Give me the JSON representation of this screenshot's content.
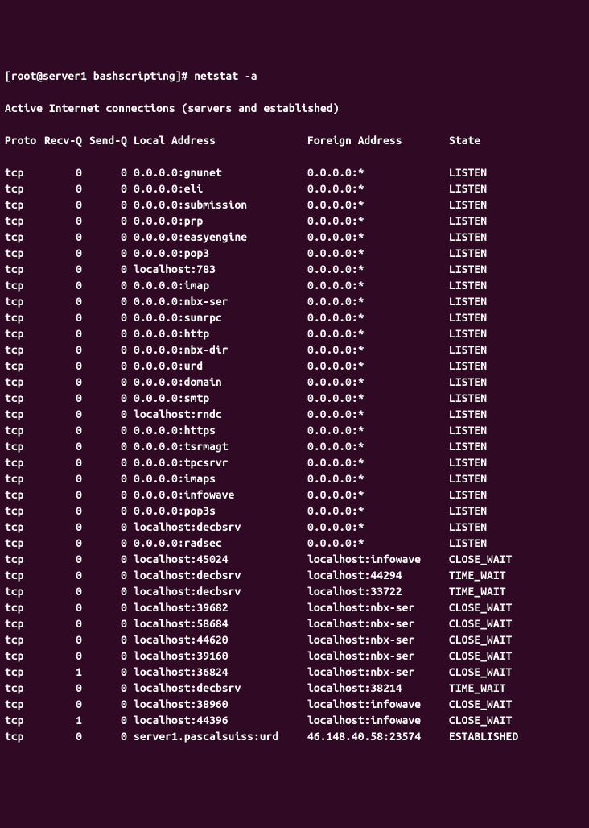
{
  "prompt": "[root@server1 bashscripting]# ",
  "command": "netstat -a",
  "header1": "Active Internet connections (servers and established)",
  "columns": {
    "proto": "Proto",
    "recvq": "Recv-Q",
    "sendq": "Send-Q",
    "local": "Local Address",
    "foreign": "Foreign Address",
    "state": "State"
  },
  "rows": [
    {
      "proto": "tcp",
      "recvq": "0",
      "sendq": "0",
      "local": "0.0.0.0:gnunet",
      "foreign": "0.0.0.0:*",
      "state": "LISTEN"
    },
    {
      "proto": "tcp",
      "recvq": "0",
      "sendq": "0",
      "local": "0.0.0.0:eli",
      "foreign": "0.0.0.0:*",
      "state": "LISTEN"
    },
    {
      "proto": "tcp",
      "recvq": "0",
      "sendq": "0",
      "local": "0.0.0.0:submission",
      "foreign": "0.0.0.0:*",
      "state": "LISTEN"
    },
    {
      "proto": "tcp",
      "recvq": "0",
      "sendq": "0",
      "local": "0.0.0.0:prp",
      "foreign": "0.0.0.0:*",
      "state": "LISTEN"
    },
    {
      "proto": "tcp",
      "recvq": "0",
      "sendq": "0",
      "local": "0.0.0.0:easyengine",
      "foreign": "0.0.0.0:*",
      "state": "LISTEN"
    },
    {
      "proto": "tcp",
      "recvq": "0",
      "sendq": "0",
      "local": "0.0.0.0:pop3",
      "foreign": "0.0.0.0:*",
      "state": "LISTEN"
    },
    {
      "proto": "tcp",
      "recvq": "0",
      "sendq": "0",
      "local": "localhost:783",
      "foreign": "0.0.0.0:*",
      "state": "LISTEN"
    },
    {
      "proto": "tcp",
      "recvq": "0",
      "sendq": "0",
      "local": "0.0.0.0:imap",
      "foreign": "0.0.0.0:*",
      "state": "LISTEN"
    },
    {
      "proto": "tcp",
      "recvq": "0",
      "sendq": "0",
      "local": "0.0.0.0:nbx-ser",
      "foreign": "0.0.0.0:*",
      "state": "LISTEN"
    },
    {
      "proto": "tcp",
      "recvq": "0",
      "sendq": "0",
      "local": "0.0.0.0:sunrpc",
      "foreign": "0.0.0.0:*",
      "state": "LISTEN"
    },
    {
      "proto": "tcp",
      "recvq": "0",
      "sendq": "0",
      "local": "0.0.0.0:http",
      "foreign": "0.0.0.0:*",
      "state": "LISTEN"
    },
    {
      "proto": "tcp",
      "recvq": "0",
      "sendq": "0",
      "local": "0.0.0.0:nbx-dir",
      "foreign": "0.0.0.0:*",
      "state": "LISTEN"
    },
    {
      "proto": "tcp",
      "recvq": "0",
      "sendq": "0",
      "local": "0.0.0.0:urd",
      "foreign": "0.0.0.0:*",
      "state": "LISTEN"
    },
    {
      "proto": "tcp",
      "recvq": "0",
      "sendq": "0",
      "local": "0.0.0.0:domain",
      "foreign": "0.0.0.0:*",
      "state": "LISTEN"
    },
    {
      "proto": "tcp",
      "recvq": "0",
      "sendq": "0",
      "local": "0.0.0.0:smtp",
      "foreign": "0.0.0.0:*",
      "state": "LISTEN"
    },
    {
      "proto": "tcp",
      "recvq": "0",
      "sendq": "0",
      "local": "localhost:rndc",
      "foreign": "0.0.0.0:*",
      "state": "LISTEN"
    },
    {
      "proto": "tcp",
      "recvq": "0",
      "sendq": "0",
      "local": "0.0.0.0:https",
      "foreign": "0.0.0.0:*",
      "state": "LISTEN"
    },
    {
      "proto": "tcp",
      "recvq": "0",
      "sendq": "0",
      "local": "0.0.0.0:tsrmagt",
      "foreign": "0.0.0.0:*",
      "state": "LISTEN"
    },
    {
      "proto": "tcp",
      "recvq": "0",
      "sendq": "0",
      "local": "0.0.0.0:tpcsrvr",
      "foreign": "0.0.0.0:*",
      "state": "LISTEN"
    },
    {
      "proto": "tcp",
      "recvq": "0",
      "sendq": "0",
      "local": "0.0.0.0:imaps",
      "foreign": "0.0.0.0:*",
      "state": "LISTEN"
    },
    {
      "proto": "tcp",
      "recvq": "0",
      "sendq": "0",
      "local": "0.0.0.0:infowave",
      "foreign": "0.0.0.0:*",
      "state": "LISTEN"
    },
    {
      "proto": "tcp",
      "recvq": "0",
      "sendq": "0",
      "local": "0.0.0.0:pop3s",
      "foreign": "0.0.0.0:*",
      "state": "LISTEN"
    },
    {
      "proto": "tcp",
      "recvq": "0",
      "sendq": "0",
      "local": "localhost:decbsrv",
      "foreign": "0.0.0.0:*",
      "state": "LISTEN"
    },
    {
      "proto": "tcp",
      "recvq": "0",
      "sendq": "0",
      "local": "0.0.0.0:radsec",
      "foreign": "0.0.0.0:*",
      "state": "LISTEN"
    },
    {
      "proto": "tcp",
      "recvq": "0",
      "sendq": "0",
      "local": "localhost:45024",
      "foreign": "localhost:infowave",
      "state": "CLOSE_WAIT"
    },
    {
      "proto": "tcp",
      "recvq": "0",
      "sendq": "0",
      "local": "localhost:decbsrv",
      "foreign": "localhost:44294",
      "state": "TIME_WAIT"
    },
    {
      "proto": "tcp",
      "recvq": "0",
      "sendq": "0",
      "local": "localhost:decbsrv",
      "foreign": "localhost:33722",
      "state": "TIME_WAIT"
    },
    {
      "proto": "tcp",
      "recvq": "0",
      "sendq": "0",
      "local": "localhost:39682",
      "foreign": "localhost:nbx-ser",
      "state": "CLOSE_WAIT"
    },
    {
      "proto": "tcp",
      "recvq": "0",
      "sendq": "0",
      "local": "localhost:58684",
      "foreign": "localhost:nbx-ser",
      "state": "CLOSE_WAIT"
    },
    {
      "proto": "tcp",
      "recvq": "0",
      "sendq": "0",
      "local": "localhost:44620",
      "foreign": "localhost:nbx-ser",
      "state": "CLOSE_WAIT"
    },
    {
      "proto": "tcp",
      "recvq": "0",
      "sendq": "0",
      "local": "localhost:39160",
      "foreign": "localhost:nbx-ser",
      "state": "CLOSE_WAIT"
    },
    {
      "proto": "tcp",
      "recvq": "1",
      "sendq": "0",
      "local": "localhost:36824",
      "foreign": "localhost:nbx-ser",
      "state": "CLOSE_WAIT"
    },
    {
      "proto": "tcp",
      "recvq": "0",
      "sendq": "0",
      "local": "localhost:decbsrv",
      "foreign": "localhost:38214",
      "state": "TIME_WAIT"
    },
    {
      "proto": "tcp",
      "recvq": "0",
      "sendq": "0",
      "local": "localhost:38960",
      "foreign": "localhost:infowave",
      "state": "CLOSE_WAIT"
    },
    {
      "proto": "tcp",
      "recvq": "1",
      "sendq": "0",
      "local": "localhost:44396",
      "foreign": "localhost:infowave",
      "state": "CLOSE_WAIT"
    },
    {
      "proto": "tcp",
      "recvq": "0",
      "sendq": "0",
      "local": "server1.pascalsuiss:urd",
      "foreign": "46.148.40.58:23574",
      "state": "ESTABLISHED"
    }
  ]
}
